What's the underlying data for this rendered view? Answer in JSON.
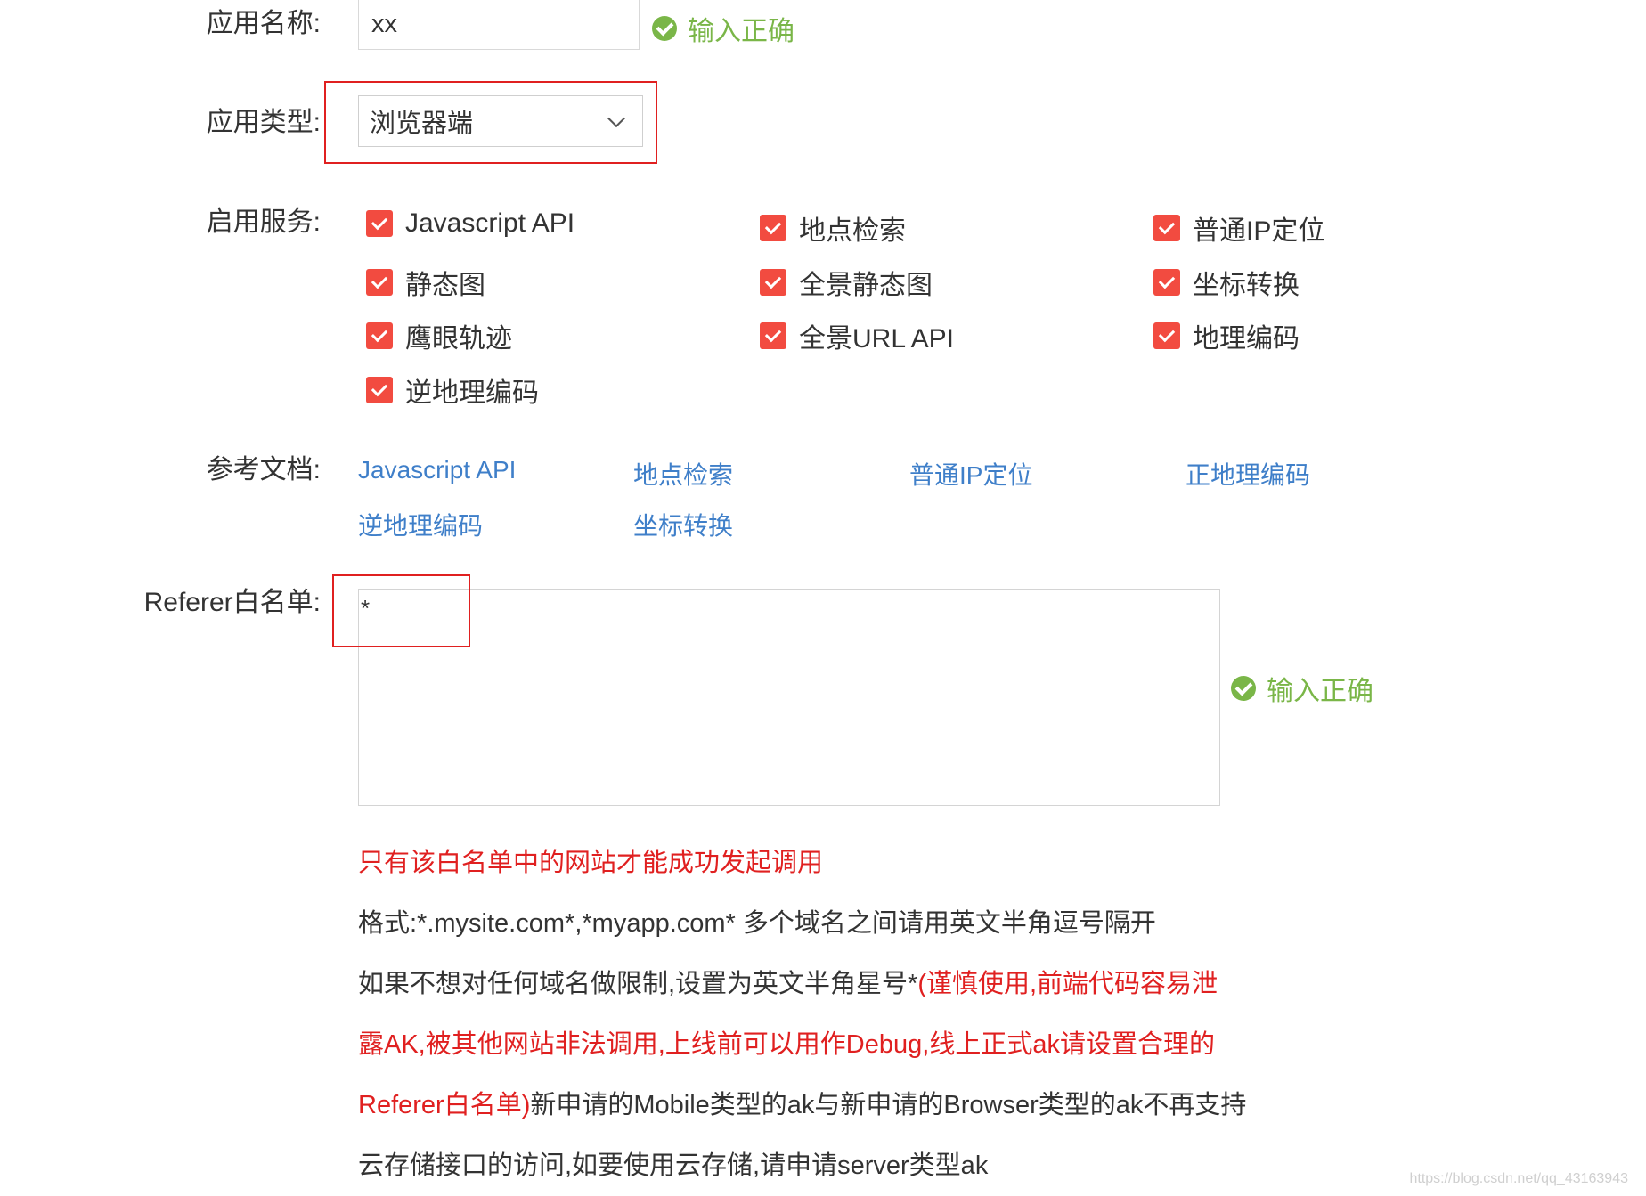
{
  "form": {
    "app_name": {
      "label": "应用名称:",
      "value": "xx",
      "validation": "输入正确"
    },
    "app_type": {
      "label": "应用类型:",
      "selected": "浏览器端"
    },
    "services": {
      "label": "启用服务:",
      "items": [
        {
          "label": "Javascript API",
          "checked": true
        },
        {
          "label": "地点检索",
          "checked": true
        },
        {
          "label": "普通IP定位",
          "checked": true
        },
        {
          "label": "静态图",
          "checked": true
        },
        {
          "label": "全景静态图",
          "checked": true
        },
        {
          "label": "坐标转换",
          "checked": true
        },
        {
          "label": "鹰眼轨迹",
          "checked": true
        },
        {
          "label": "全景URL API",
          "checked": true
        },
        {
          "label": "地理编码",
          "checked": true
        },
        {
          "label": "逆地理编码",
          "checked": true
        }
      ]
    },
    "docs": {
      "label": "参考文档:",
      "links": [
        "Javascript API",
        "地点检索",
        "普通IP定位",
        "正地理编码",
        "逆地理编码",
        "坐标转换"
      ]
    },
    "referer": {
      "label": "Referer白名单:",
      "value": "*",
      "validation": "输入正确",
      "notes": {
        "line1": "只有该白名单中的网站才能成功发起调用",
        "line2": "格式:*.mysite.com*,*myapp.com* 多个域名之间请用英文半角逗号隔开",
        "line3_plain": "如果不想对任何域名做限制,设置为英文半角星号*",
        "line3_red": "(谨慎使用,前端代码容易泄",
        "line4_red": "露AK,被其他网站非法调用,上线前可以用作Debug,线上正式ak请设置合理的",
        "line5_red": "Referer白名单)",
        "line5_plain": "新申请的Mobile类型的ak与新申请的Browser类型的ak不再支持",
        "line6": "云存储接口的访问,如要使用云存储,请申请server类型ak"
      }
    }
  },
  "watermark": "https://blog.csdn.net/qq_43163943",
  "colors": {
    "accent_red": "#f24b40",
    "valid_green": "#7ab648",
    "link_blue": "#3f7fc9",
    "warning_red": "#e02020"
  }
}
